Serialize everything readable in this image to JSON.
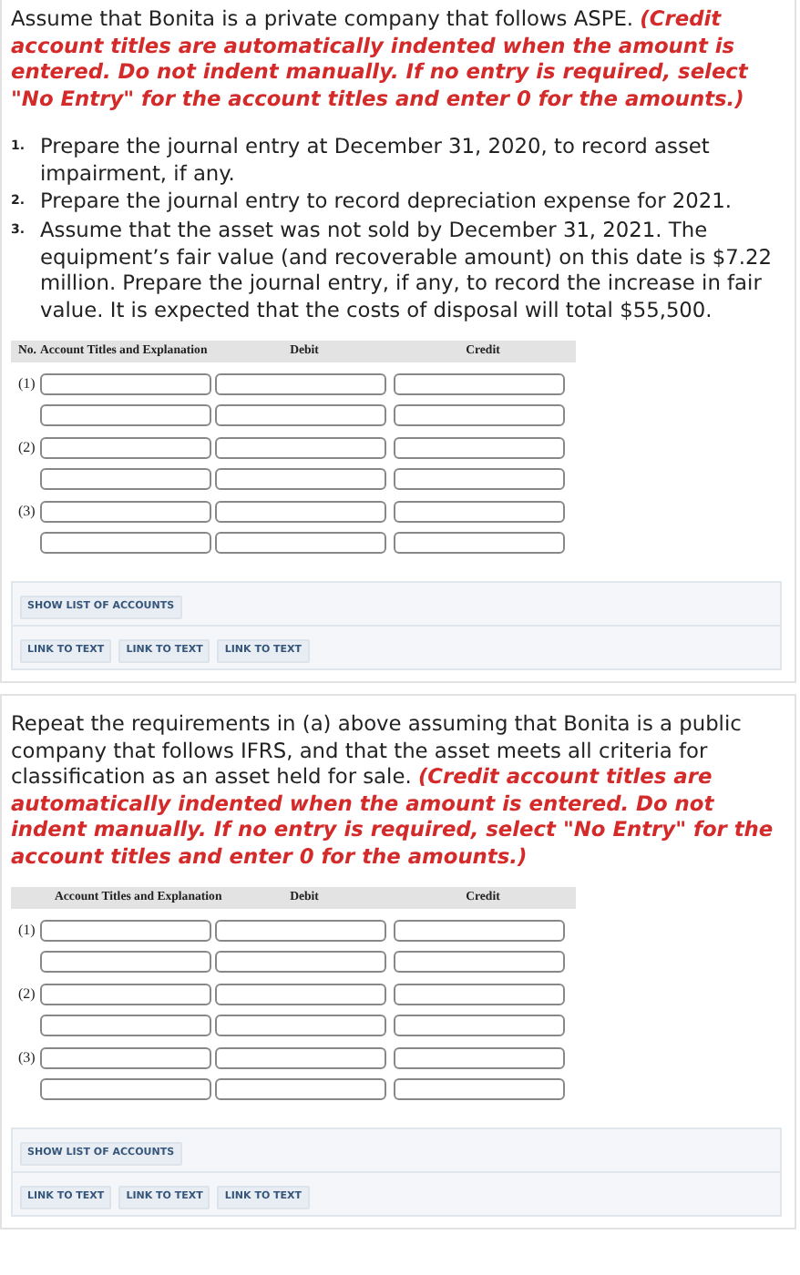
{
  "parts": [
    {
      "intro": "Assume that Bonita is a private company that follows ASPE.",
      "instruction": "(Credit account titles are automatically indented when the amount is entered. Do not indent manually. If no entry is required, select \"No Entry\" for the account titles and enter 0 for the amounts.)",
      "requirements": [
        {
          "number": "1.",
          "text": "Prepare the journal entry at December 31, 2020, to record asset impairment, if any."
        },
        {
          "number": "2.",
          "text": "Prepare the journal entry to record depreciation expense for 2021."
        },
        {
          "number": "3.",
          "text": "Assume that the asset was not sold by December 31, 2021. The equipment’s fair value (and recoverable amount) on this date is $7.22 million. Prepare the journal entry, if any, to record the increase in fair value. It is expected that the costs of disposal will total $55,500."
        }
      ],
      "table": {
        "number_heading": "No.",
        "columns": [
          "Account Titles and Explanation",
          "Debit",
          "Credit"
        ],
        "rows": [
          {
            "kind": "numbered",
            "label": "(1)"
          },
          {
            "kind": "blank"
          },
          {
            "kind": "numbered",
            "label": "(2)"
          },
          {
            "kind": "blank"
          },
          {
            "kind": "numbered",
            "label": "(3)"
          },
          {
            "kind": "blank"
          }
        ]
      },
      "accounts_button": "SHOW LIST OF ACCOUNTS",
      "links": [
        "LINK TO TEXT",
        "LINK TO TEXT",
        "LINK TO TEXT"
      ]
    },
    {
      "intro": "Repeat the requirements in (a) above assuming that Bonita is a public company that follows IFRS, and that the asset meets all criteria for classification as an asset held for sale.",
      "instruction": "(Credit account titles are automatically indented when the amount is entered. Do not indent manually. If no entry is required, select \"No Entry\" for the account titles and enter 0 for the amounts.)",
      "table": {
        "columns": [
          "Account Titles and Explanation",
          "Debit",
          "Credit"
        ],
        "rows": [
          {
            "kind": "numbered",
            "label": "(1)"
          },
          {
            "kind": "blank"
          },
          {
            "kind": "numbered",
            "label": "(2)"
          },
          {
            "kind": "blank"
          },
          {
            "kind": "numbered",
            "label": "(3)"
          },
          {
            "kind": "blank"
          }
        ]
      },
      "accounts_button": "SHOW LIST OF ACCOUNTS",
      "links": [
        "LINK TO TEXT",
        "LINK TO TEXT",
        "LINK TO TEXT"
      ]
    }
  ]
}
